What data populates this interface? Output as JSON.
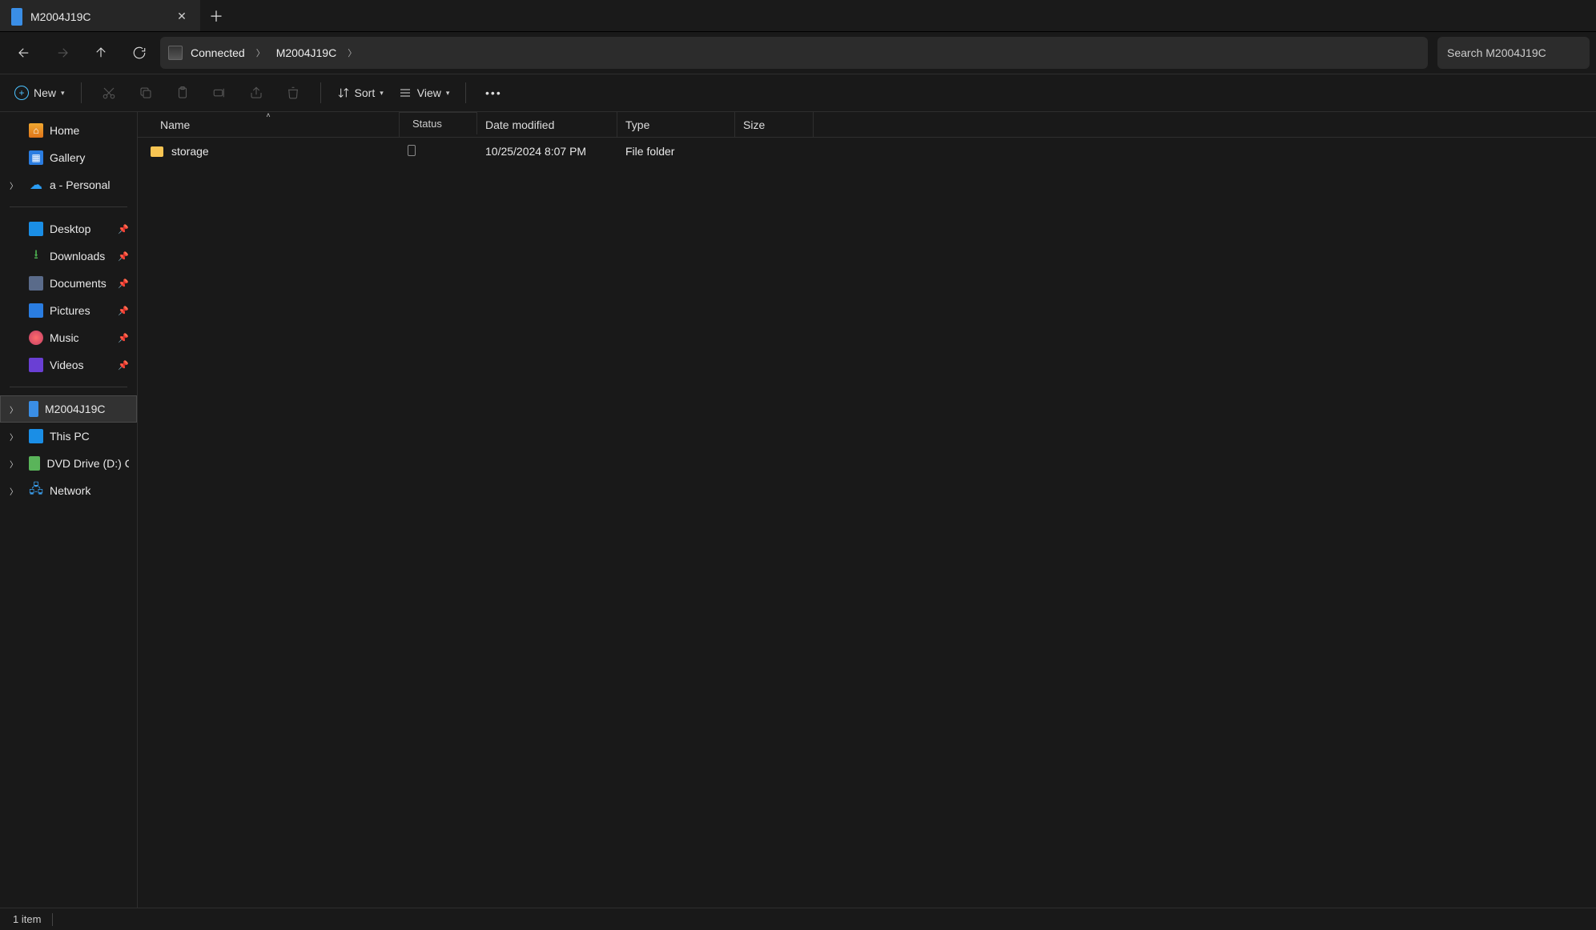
{
  "tab": {
    "title": "M2004J19C"
  },
  "address": {
    "root": "Connected",
    "segment": "M2004J19C"
  },
  "search": {
    "placeholder": "Search M2004J19C"
  },
  "toolbar": {
    "new": "New",
    "sort": "Sort",
    "view": "View"
  },
  "columns": {
    "name": "Name",
    "status": "Status",
    "date": "Date modified",
    "type": "Type",
    "size": "Size"
  },
  "rows": [
    {
      "name": "storage",
      "status": "",
      "date": "10/25/2024 8:07 PM",
      "type": "File folder",
      "size": ""
    }
  ],
  "sidebar": {
    "top": [
      {
        "label": "Home"
      },
      {
        "label": "Gallery"
      },
      {
        "label": "a - Personal"
      }
    ],
    "quick": [
      {
        "label": "Desktop"
      },
      {
        "label": "Downloads"
      },
      {
        "label": "Documents"
      },
      {
        "label": "Pictures"
      },
      {
        "label": "Music"
      },
      {
        "label": "Videos"
      }
    ],
    "bottom": [
      {
        "label": "M2004J19C"
      },
      {
        "label": "This PC"
      },
      {
        "label": "DVD Drive (D:) CCC"
      },
      {
        "label": "Network"
      }
    ]
  },
  "statusbar": {
    "count": "1 item"
  }
}
